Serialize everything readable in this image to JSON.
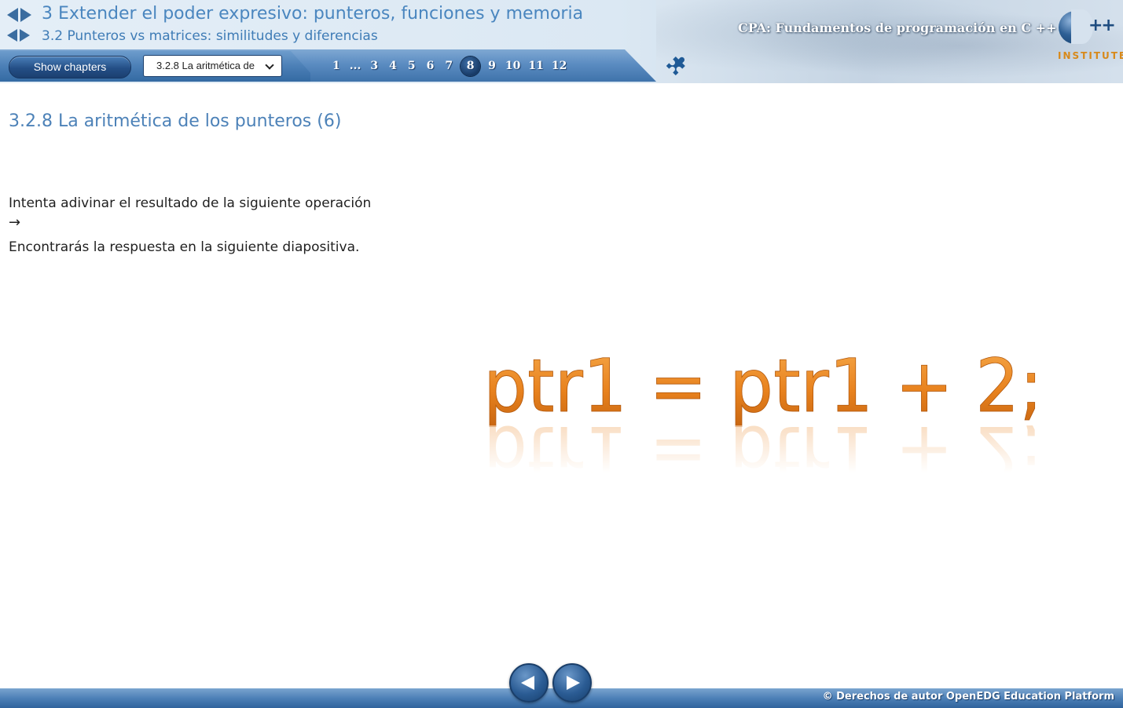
{
  "header": {
    "chapter_title": "3 Extender el poder expresivo: punteros, funciones y memoria",
    "section_title": "3.2 Punteros vs matrices: similitudes y diferencias",
    "course_title": "CPA: Fundamentos de programación en C ++",
    "logo_mark": "C++",
    "logo_text": "INSTITUTE"
  },
  "navbar": {
    "show_chapters_label": "Show chapters",
    "slide_select_value": "3.2.8 La aritmética de",
    "pages": [
      "1",
      "...",
      "3",
      "4",
      "5",
      "6",
      "7",
      "8",
      "9",
      "10",
      "11",
      "12"
    ],
    "current_page": "8",
    "puzzle_icon": "puzzle-icon"
  },
  "content": {
    "heading": "3.2.8 La aritmética de los punteros (6)",
    "line1": "Intenta adivinar el resultado de la siguiente operación",
    "line2": "→",
    "line3": "Encontrarás la respuesta en la siguiente diapositiva.",
    "code_text": "ptr1 = ptr1 + 2;"
  },
  "footer": {
    "copyright": "© Derechos de autor OpenEDG Education Platform",
    "prev_icon": "prev-arrow-icon",
    "next_icon": "next-arrow-icon"
  },
  "colors": {
    "accent_blue": "#4a86bf",
    "code_orange": "#e8821e"
  }
}
